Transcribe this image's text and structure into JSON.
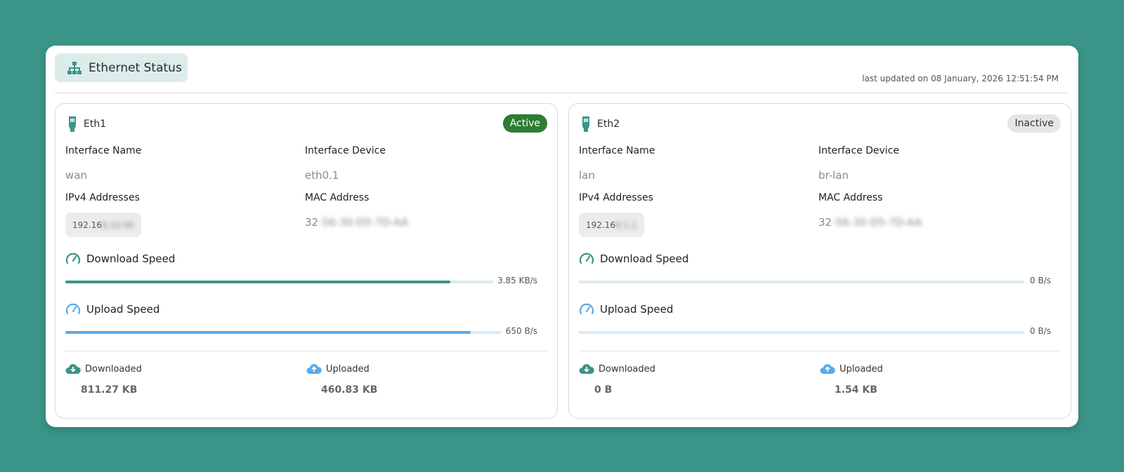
{
  "header": {
    "title": "Ethernet Status",
    "last_updated": "last updated on 08 January, 2026 12:51:54 PM"
  },
  "colors": {
    "accent": "#3a9488",
    "download_bar": "#3a9488",
    "upload_bar": "#5aaae8",
    "active_badge": "#2e7d32"
  },
  "interfaces": [
    {
      "port": "Eth1",
      "status": "Active",
      "interface_name_label": "Interface Name",
      "interface_name": "wan",
      "interface_device_label": "Interface Device",
      "interface_device": "eth0.1",
      "ipv4_label": "IPv4 Addresses",
      "ipv4_visible": "192.16",
      "ipv4_masked": "8.10.90",
      "mac_label": "MAC Address",
      "mac_visible": "32",
      "mac_masked": "-56-30-D5-7D-AA",
      "download_label": "Download Speed",
      "download_speed": "3.85 KB/s",
      "download_fraction": 0.9,
      "upload_label": "Upload Speed",
      "upload_speed": "650 B/s",
      "upload_fraction": 0.93,
      "downloaded_label": "Downloaded",
      "downloaded": "811.27 KB",
      "uploaded_label": "Uploaded",
      "uploaded": "460.83 KB"
    },
    {
      "port": "Eth2",
      "status": "Inactive",
      "interface_name_label": "Interface Name",
      "interface_name": "lan",
      "interface_device_label": "Interface Device",
      "interface_device": "br-lan",
      "ipv4_label": "IPv4 Addresses",
      "ipv4_visible": "192.16",
      "ipv4_masked": "8.1.1",
      "mac_label": "MAC Address",
      "mac_visible": "32",
      "mac_masked": "-56-30-D5-7D-AA",
      "download_label": "Download Speed",
      "download_speed": "0 B/s",
      "download_fraction": 0,
      "upload_label": "Upload Speed",
      "upload_speed": "0 B/s",
      "upload_fraction": 0,
      "downloaded_label": "Downloaded",
      "downloaded": "0 B",
      "uploaded_label": "Uploaded",
      "uploaded": "1.54 KB"
    }
  ]
}
